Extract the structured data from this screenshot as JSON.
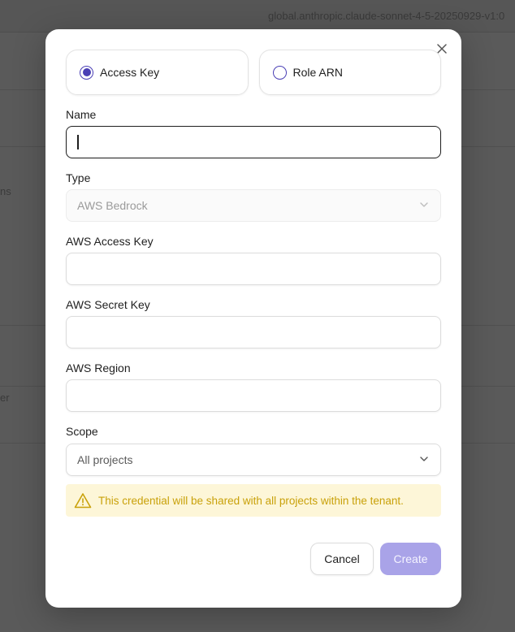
{
  "background": {
    "topbar_text": "global.anthropic.claude-sonnet-4-5-20250929-v1:0",
    "side_text_1": "ns",
    "side_text_2": "",
    "side_text_3": "er"
  },
  "modal": {
    "auth_options": [
      {
        "label": "Access Key",
        "selected": true
      },
      {
        "label": "Role ARN",
        "selected": false
      }
    ],
    "name": {
      "label": "Name",
      "value": ""
    },
    "type": {
      "label": "Type",
      "value": "AWS Bedrock"
    },
    "access_key": {
      "label": "AWS Access Key",
      "value": ""
    },
    "secret_key": {
      "label": "AWS Secret Key",
      "value": ""
    },
    "region": {
      "label": "AWS Region",
      "value": ""
    },
    "scope": {
      "label": "Scope",
      "value": "All projects"
    },
    "warning": "This credential will be shared with all projects within the tenant.",
    "buttons": {
      "cancel": "Cancel",
      "create": "Create"
    }
  },
  "colors": {
    "accent": "#4a3fb5",
    "create_button": "#a9a3e8",
    "warning_bg": "#fdf6d8",
    "warning_text": "#c9a10a"
  }
}
